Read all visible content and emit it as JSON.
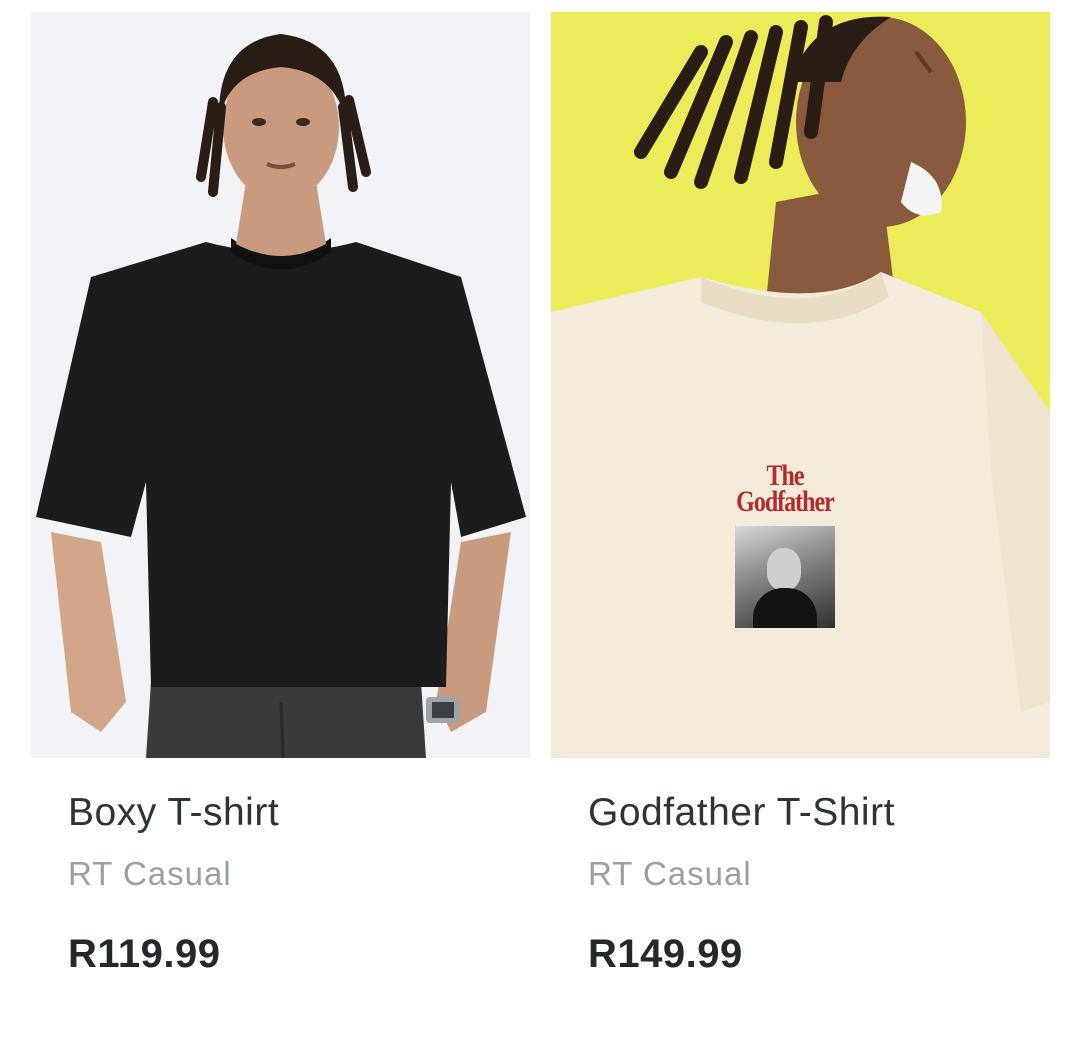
{
  "products": [
    {
      "name": "Boxy T-shirt",
      "brand": "RT Casual",
      "price": "R119.99",
      "image_icon": "product-photo-black-tshirt"
    },
    {
      "name": "Godfather T-Shirt",
      "brand": "RT Casual",
      "price": "R149.99",
      "image_icon": "product-photo-cream-tshirt",
      "print_text_line1": "The",
      "print_text_line2": "Godfather"
    }
  ],
  "colors": {
    "card_bg_light": "#f2f3f7",
    "card_bg_yellow": "#ecec5a",
    "text_primary": "#2e3338",
    "text_secondary": "#9a9fa4",
    "price": "#24282d",
    "print_red": "#b52a2a"
  }
}
